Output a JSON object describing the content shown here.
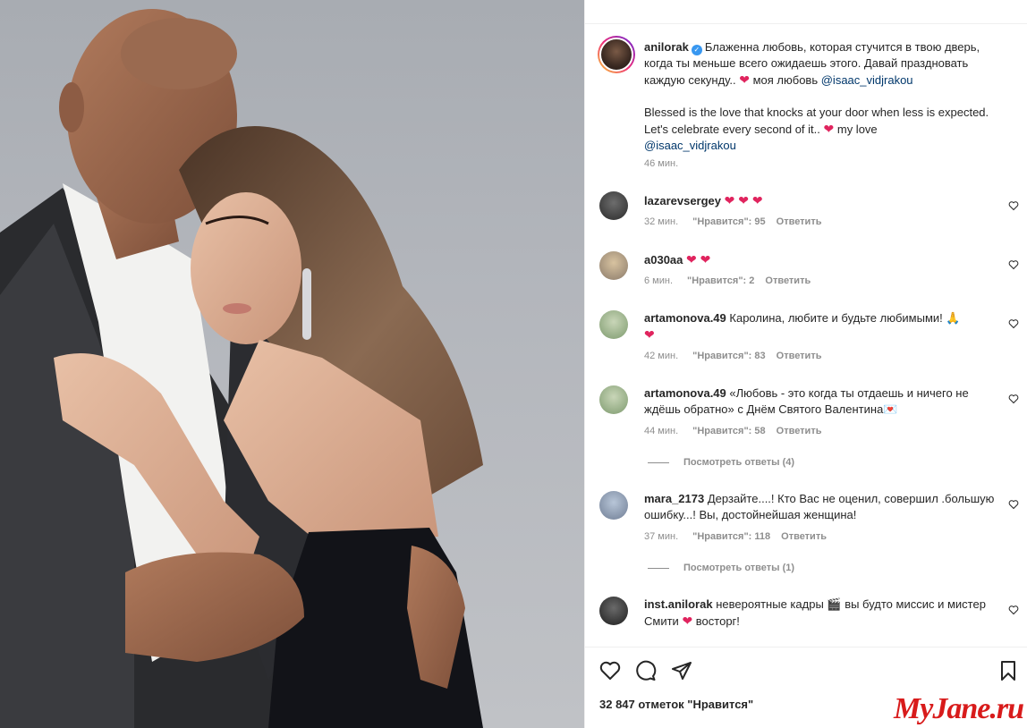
{
  "post": {
    "username": "anilorak",
    "caption_ru": "Блаженна любовь, которая стучится в твою дверь, когда ты меньше всего ожидаешь этого. Давай праздновать каждую секунду..",
    "caption_ru_love": "моя любовь",
    "mention": "@isaac_vidjrakou",
    "caption_en": "Blessed is the love that knocks at your door when less is expected. Let's celebrate every second of it..",
    "caption_en_love": "my love",
    "time": "46 мин."
  },
  "labels": {
    "likes_prefix": "\"Нравится\":",
    "reply": "Ответить",
    "view_replies_4": "Посмотреть ответы (4)",
    "view_replies_1": "Посмотреть ответы (1)"
  },
  "comments": [
    {
      "user": "lazarevsergey",
      "text": "",
      "time": "32 мин.",
      "likes": "95"
    },
    {
      "user": "a030aa",
      "text": "",
      "time": "6 мин.",
      "likes": "2"
    },
    {
      "user": "artamonova.49",
      "text": "Каролина, любите и будьте любимыми! 🙏",
      "time": "42 мин.",
      "likes": "83"
    },
    {
      "user": "artamonova.49",
      "text": "«Любовь - это когда ты отдаешь и ничего не ждёшь обратно» с Днём Святого Валентина💌",
      "time": "44 мин.",
      "likes": "58"
    },
    {
      "user": "mara_2173",
      "text": "Дерзайте....! Кто Вас не оценил, совершил .большую ошибку...! Вы, достойнейшая женщина!",
      "time": "37 мин.",
      "likes": "118"
    },
    {
      "user": "inst.anilorak",
      "text_a": "невероятные кадры 🎬 вы будто миссис и мистер Смити",
      "text_b": "восторг!"
    }
  ],
  "hearts": {
    "one": "❤",
    "two": "❤ ❤",
    "three": "❤ ❤ ❤"
  },
  "footer": {
    "likes_count": "32 847 отметок \"Нравится\""
  },
  "watermark": "MyJane.ru",
  "colors": {
    "heart": "#e0245e",
    "mention": "#00376b",
    "muted": "#8e8e8e",
    "watermark": "#d81b1b"
  }
}
